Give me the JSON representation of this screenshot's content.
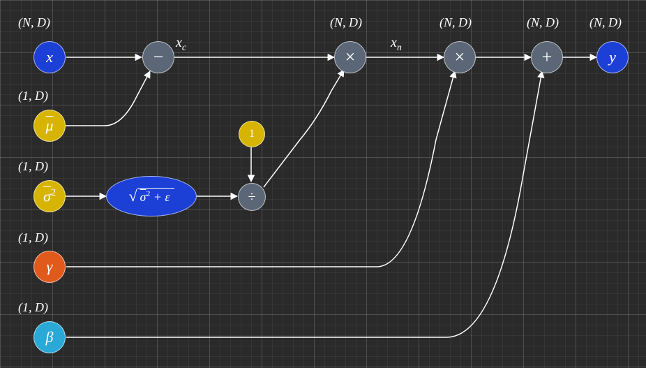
{
  "dims": {
    "ND": "(N, D)",
    "oneD": "(1, D)"
  },
  "nodes": {
    "x": {
      "label": "x"
    },
    "mu": {
      "label": "μ̄"
    },
    "sigma2": {
      "label": "σ̄²"
    },
    "gamma": {
      "label": "γ"
    },
    "beta": {
      "label": "β"
    },
    "y": {
      "label": "y"
    },
    "minus": {
      "label": "−"
    },
    "mult1": {
      "label": "×"
    },
    "mult2": {
      "label": "×"
    },
    "plus": {
      "label": "+"
    },
    "div": {
      "label": "÷"
    },
    "one": {
      "label": "1"
    },
    "sqrt": {
      "prefix": "√",
      "radicand": "σ̄² + ε"
    }
  },
  "edge_labels": {
    "xc": "xₙ",
    "xcenter": "x",
    "xc_sub": "c",
    "xn_sub": "n"
  }
}
